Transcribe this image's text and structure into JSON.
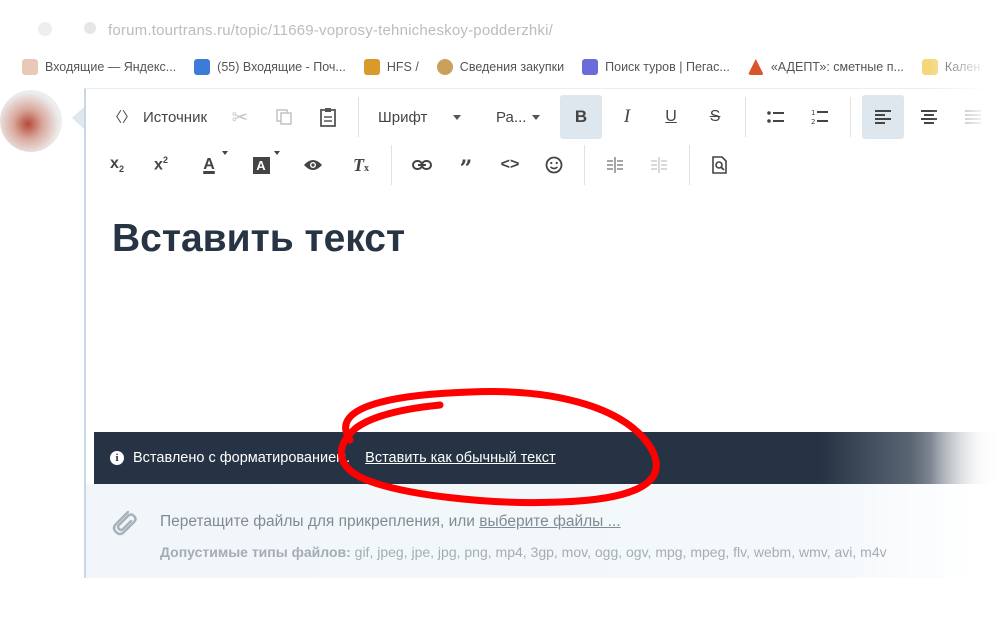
{
  "browser": {
    "url": "forum.tourtrans.ru/topic/11669-voprosy-tehnicheskoy-podderzhki/"
  },
  "bookmarks": [
    {
      "label": "Входящие — Яндекс...",
      "icon": "mail-icon",
      "color": "#e8c9b8"
    },
    {
      "label": "(55) Входящие - Поч...",
      "icon": "envelope-icon",
      "color": "#3d7bd9"
    },
    {
      "label": "HFS /",
      "icon": "hfs-icon",
      "color": "#d99a2b"
    },
    {
      "label": "Сведения закупки",
      "icon": "emblem-icon",
      "color": "#c9a15b"
    },
    {
      "label": "Поиск туров | Пегас...",
      "icon": "pegas-icon",
      "color": "#6b6bd9"
    },
    {
      "label": "«АДЕПТ»: сметные п...",
      "icon": "adept-icon",
      "color": "#d9552b"
    },
    {
      "label": "Кален",
      "icon": "folder-icon",
      "color": "#f5d77a"
    }
  ],
  "toolbar": {
    "source_label": "Источник",
    "font_label": "Шрифт",
    "size_label": "Ра..."
  },
  "editor": {
    "content_heading": "Вставить текст"
  },
  "notice": {
    "message": "Вставлено с форматированием.",
    "action_label": "Вставить как обычный текст"
  },
  "attachments": {
    "prompt_prefix": "Перетащите файлы для прикрепления, или ",
    "prompt_link": "выберите файлы ...",
    "types_label": "Допустимые типы файлов:",
    "types_list": " gif, jpeg, jpe, jpg, png, mp4, 3gp, mov, ogg, ogv, mpg, mpeg, flv, webm, wmv, avi, m4v"
  },
  "colors": {
    "notice_bg": "#253344",
    "active_button_bg": "#dfe7ee",
    "heading_text": "#273444",
    "annotation": "#ff0000"
  }
}
